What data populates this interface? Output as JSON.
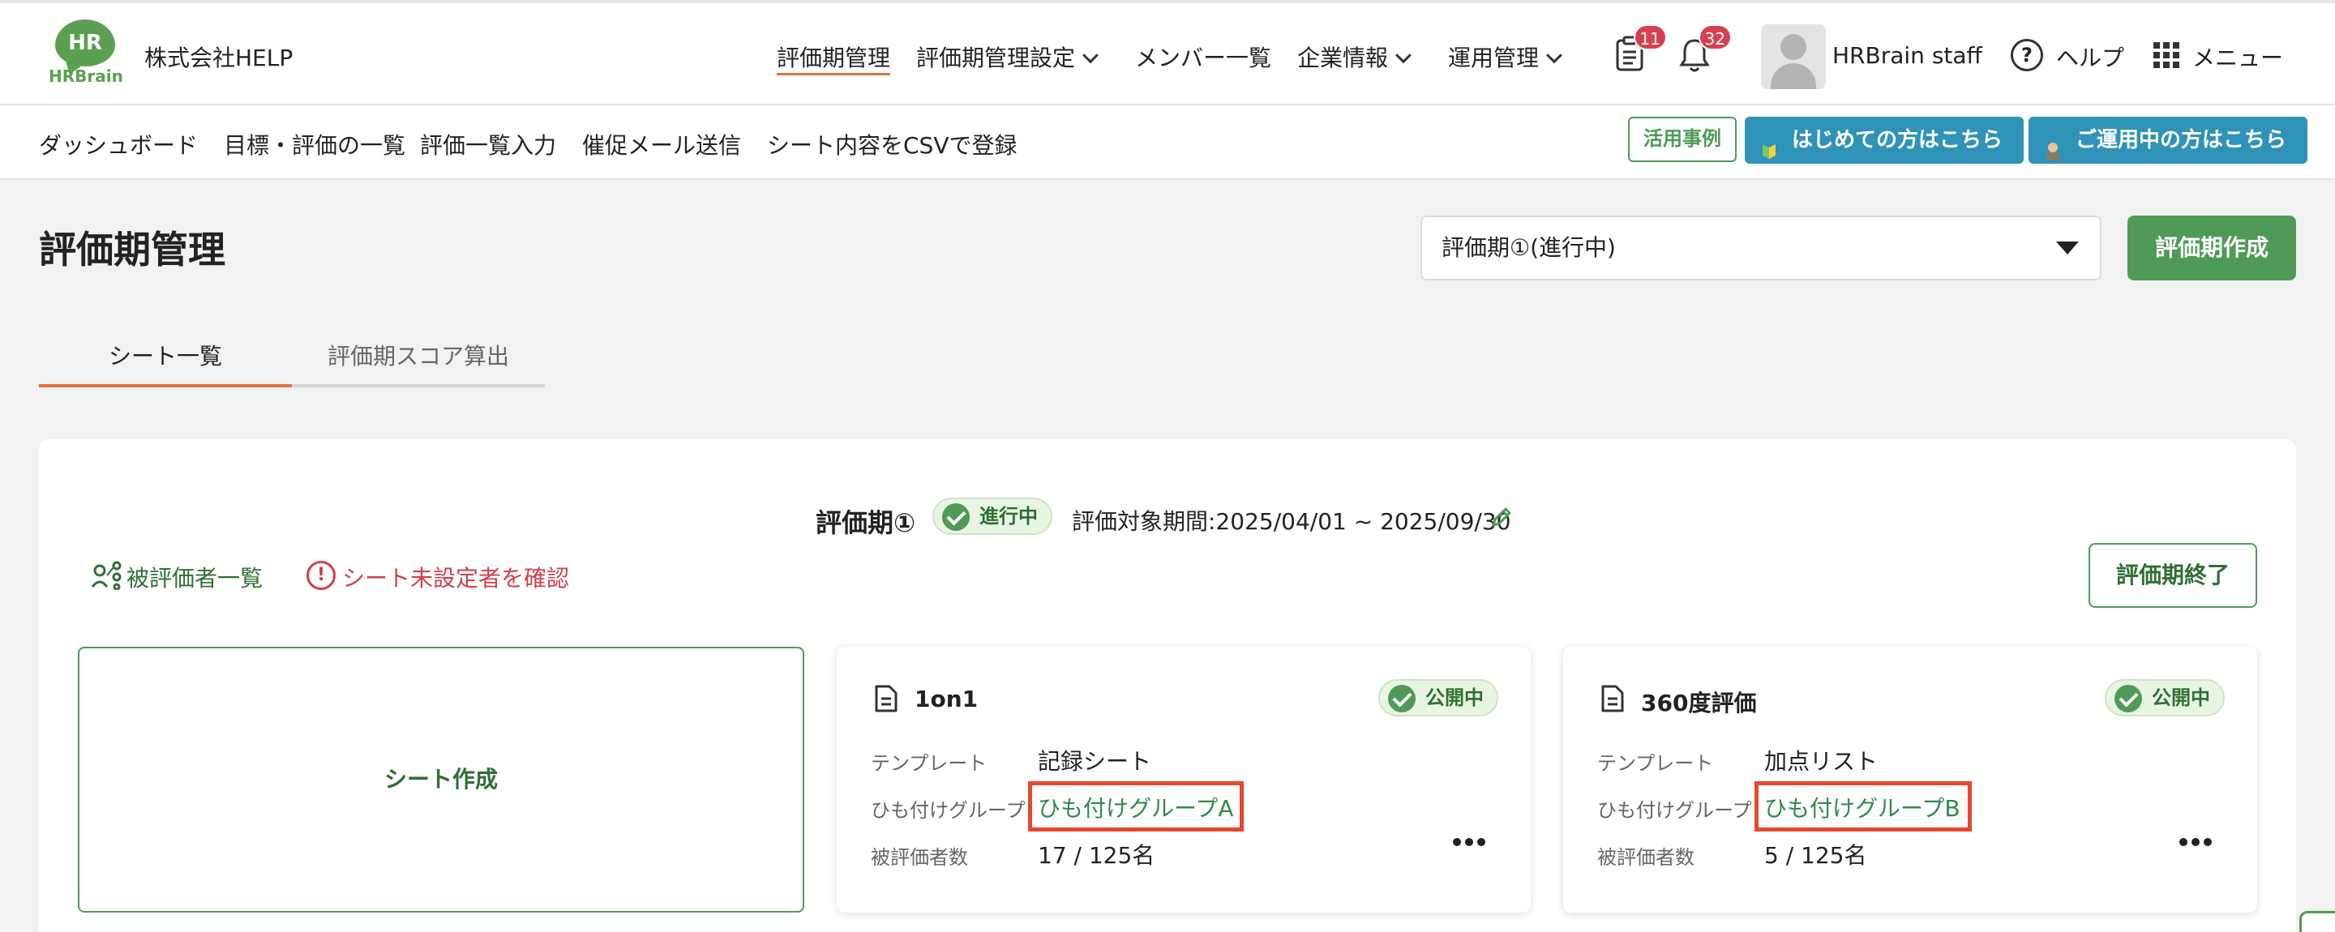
{
  "header": {
    "logo_initials": "HR",
    "logo_word": "HRBrain",
    "company": "株式会社HELP",
    "nav": [
      {
        "label": "評価期管理"
      },
      {
        "label": "評価期管理設定"
      },
      {
        "label": "メンバー一覧"
      },
      {
        "label": "企業情報"
      },
      {
        "label": "運用管理"
      }
    ],
    "clipboard_badge": "11",
    "bell_badge": "32",
    "username": "HRBrain staff",
    "help_glyph": "?",
    "help_label": "ヘルプ",
    "menu_label": "メニュー"
  },
  "subnav": {
    "items": [
      {
        "label": "ダッシュボード"
      },
      {
        "label": "目標・評価の一覧"
      },
      {
        "label": "評価一覧入力"
      },
      {
        "label": "催促メール送信"
      },
      {
        "label": "シート内容をCSVで登録"
      }
    ],
    "case_studies": "活用事例",
    "beginner_label": "はじめての方はこちら",
    "operating_label": "ご運用中の方はこちら"
  },
  "page": {
    "title": "評価期管理",
    "period_select_value": "評価期①(進行中)",
    "create_period_label": "評価期作成",
    "tabs": [
      {
        "label": "シート一覧"
      },
      {
        "label": "評価期スコア算出"
      }
    ]
  },
  "period": {
    "name": "評価期①",
    "status": "進行中",
    "range": "評価対象期間:2025/04/01 ~ 2025/09/30",
    "evaluatee_link": "被評価者一覧",
    "unset_link": "シート未設定者を確認",
    "alert_glyph": "!",
    "end_label": "評価期終了"
  },
  "sheets": {
    "create_label": "シート作成",
    "cards": [
      {
        "title": "1on1",
        "status": "公開中",
        "template_label": "テンプレート",
        "template_value": "記録シート",
        "group_label": "ひも付けグループ",
        "group_value": "ひも付けグループA",
        "count_label": "被評価者数",
        "count_value": "17 / 125名"
      },
      {
        "title": "360度評価",
        "status": "公開中",
        "template_label": "テンプレート",
        "template_value": "加点リスト",
        "group_label": "ひも付けグループ",
        "group_value": "ひも付けグループB",
        "count_label": "被評価者数",
        "count_value": "5 / 125名"
      }
    ]
  },
  "colors": {
    "brand_green": "#4f9a56",
    "accent_orange": "#e2733a",
    "info_blue": "#2f93b8",
    "alert_red": "#d0404a",
    "highlight_red": "#e5472f"
  }
}
